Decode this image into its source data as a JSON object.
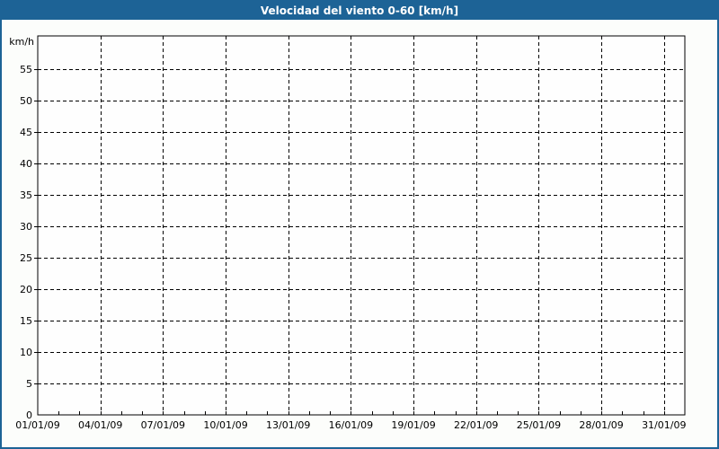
{
  "window": {
    "title": "Velocidad del viento 0-60 [km/h]"
  },
  "chart_data": {
    "type": "line",
    "title": "Velocidad del viento 0-60 [km/h]",
    "y_unit_label": "km/h",
    "x_tick_labels": [
      "01/01/09",
      "04/01/09",
      "07/01/09",
      "10/01/09",
      "13/01/09",
      "16/01/09",
      "19/01/09",
      "22/01/09",
      "25/01/09",
      "28/01/09",
      "31/01/09"
    ],
    "x_major_step_days": 3,
    "x_minor_step_days": 1,
    "xlim_days": [
      0,
      31
    ],
    "y_tick_labels": [
      0,
      5,
      10,
      15,
      20,
      25,
      30,
      35,
      40,
      45,
      50,
      55
    ],
    "ylim": [
      0,
      60.3
    ],
    "grid_style": "dashed",
    "legend": "none",
    "series": [],
    "colors": {
      "frame_border": "#1d6396",
      "title_bar_bg": "#1d6396",
      "title_text": "#ffffff",
      "page_bg": "#fcfdfb",
      "plot_bg": "#fefefe",
      "axis": "#000000",
      "grid": "#000000",
      "tick_label": "#000000"
    }
  }
}
